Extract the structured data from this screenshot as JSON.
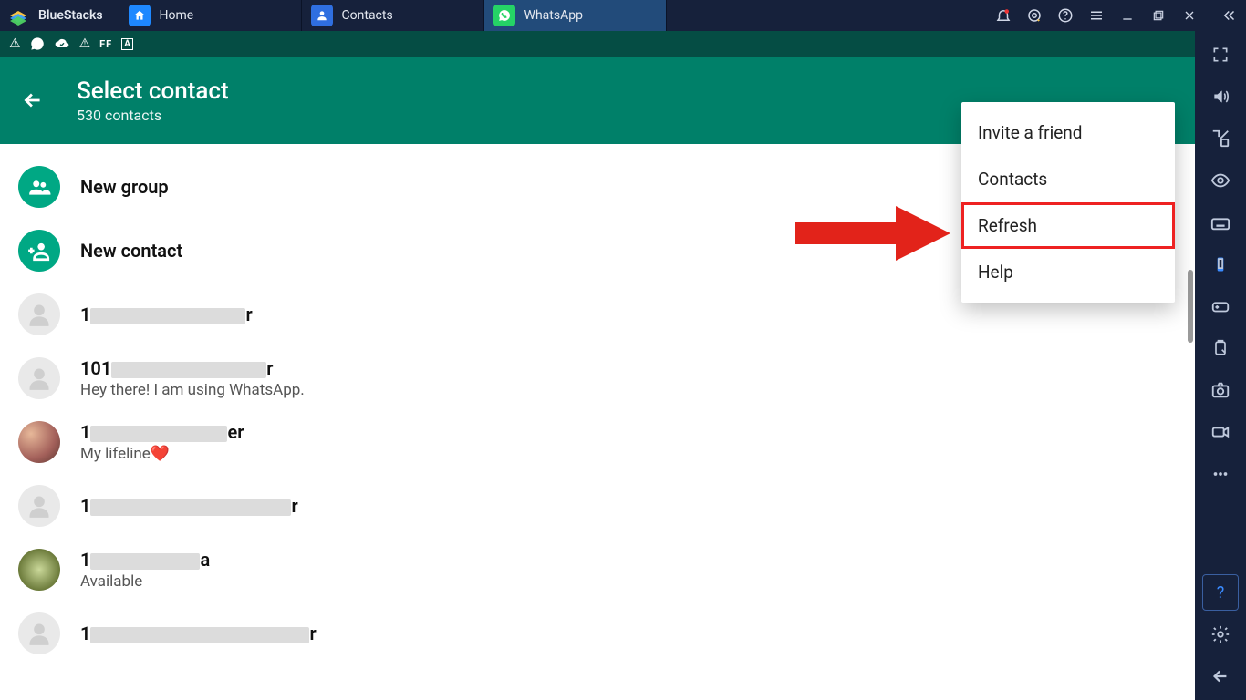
{
  "titlebar": {
    "brand": "BlueStacks",
    "tabs": [
      {
        "label": "Home",
        "active": false,
        "icon_bg": "#1e88ff"
      },
      {
        "label": "Contacts",
        "active": false,
        "icon_bg": "#2f6fe0"
      },
      {
        "label": "WhatsApp",
        "active": true,
        "icon_bg": "#25d366"
      }
    ]
  },
  "header": {
    "title": "Select contact",
    "subtitle": "530 contacts"
  },
  "actions": {
    "new_group": "New group",
    "new_contact": "New contact"
  },
  "contacts": [
    {
      "name_prefix": "1",
      "name_suffix": "r",
      "status": "",
      "avatar": "blank",
      "redact_w": 170
    },
    {
      "name_prefix": "101",
      "name_suffix": "r",
      "status": "Hey there! I am using WhatsApp.",
      "avatar": "blank",
      "redact_w": 170
    },
    {
      "name_prefix": "1",
      "name_suffix": "er",
      "status": "My lifeline❤️",
      "avatar": "photo1",
      "redact_w": 150
    },
    {
      "name_prefix": "1",
      "name_suffix": "r",
      "status": "",
      "avatar": "blank",
      "redact_w": 220
    },
    {
      "name_prefix": "1",
      "name_suffix": "a",
      "status": "Available",
      "avatar": "photo2",
      "redact_w": 120
    },
    {
      "name_prefix": "1",
      "name_suffix": "r",
      "status": "",
      "avatar": "blank",
      "redact_w": 240
    }
  ],
  "menu": {
    "items": [
      "Invite a friend",
      "Contacts",
      "Refresh",
      "Help"
    ],
    "highlight_index": 2
  }
}
